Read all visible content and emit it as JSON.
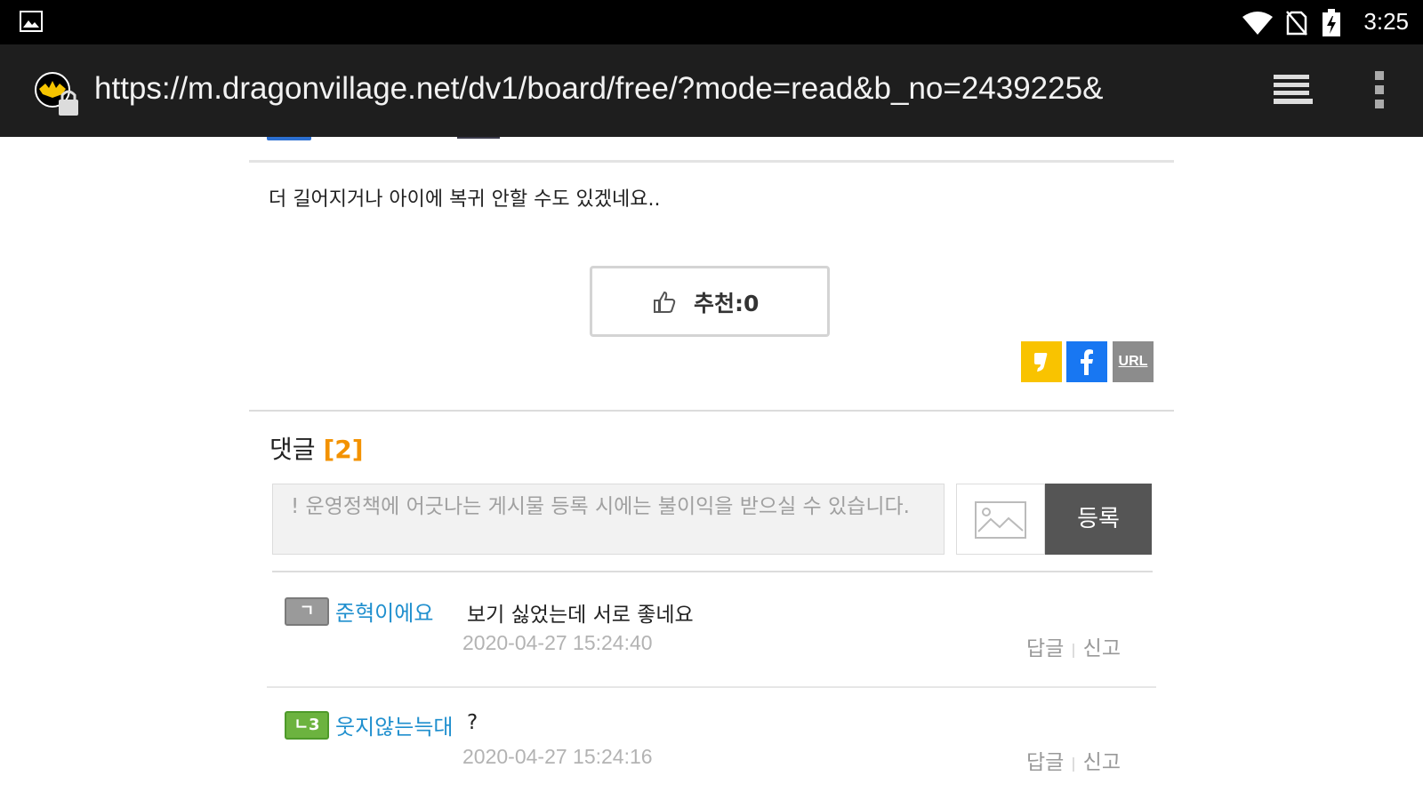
{
  "status_bar": {
    "time": "3:25",
    "icons": [
      "gallery-icon",
      "wifi-icon",
      "no-sim-icon",
      "battery-charging-icon"
    ]
  },
  "browser": {
    "url": "https://m.dragonvillage.net/dv1/board/free/?mode=read&b_no=2439225&",
    "icons": [
      "site-favicon-icon",
      "lock-icon",
      "tabs-icon",
      "overflow-menu-icon"
    ]
  },
  "post": {
    "body": "더 길어지거나 아이에 복귀 안할 수도 있겠네요..",
    "recommend_label": "추천:0",
    "share": {
      "url_label": "URL"
    }
  },
  "comments": {
    "title": "댓글",
    "count": "[2]",
    "input_placeholder": "! 운영정책에 어긋나는 게시물 등록 시에는 불이익을 받으실 수 있습니다.",
    "submit_label": "등록",
    "items": [
      {
        "level": "ㄱ",
        "author": "준혁이에요",
        "text": "보기 싫었는데 서로 좋네요",
        "date": "2020-04-27 15:24:40",
        "reply_label": "답글",
        "report_label": "신고"
      },
      {
        "level": "ㄴ3",
        "author": "웃지않는늑대",
        "text": "?",
        "date": "2020-04-27 15:24:16",
        "reply_label": "답글",
        "report_label": "신고"
      }
    ]
  },
  "colors": {
    "accent_orange": "#f39200",
    "link_blue": "#1f8fce",
    "kakao_yellow": "#f9c300",
    "facebook_blue": "#1877f2",
    "submit_gray": "#555555"
  }
}
